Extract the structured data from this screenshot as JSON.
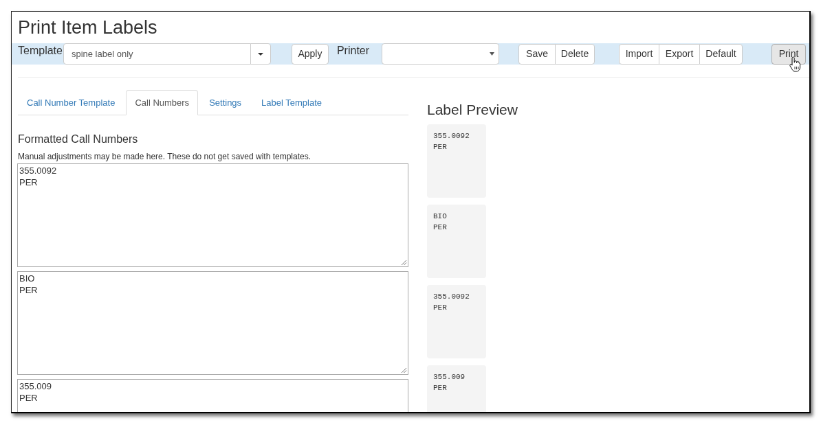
{
  "window": {
    "title": "Print Item Labels"
  },
  "toolbar": {
    "template_label": "Template",
    "template_field": {
      "value": "spine label only"
    },
    "apply_button": "Apply",
    "printer_label": "Printer",
    "template_buttons": [
      "Save",
      "Delete"
    ],
    "file_buttons": [
      "Import",
      "Export",
      "Default"
    ],
    "print_button": {
      "label": "Print",
      "hovered": true
    }
  },
  "tabs": [
    {
      "label": "Call Number Template",
      "selected": false
    },
    {
      "label": "Call Numbers",
      "selected": true
    },
    {
      "label": "Settings",
      "selected": false
    },
    {
      "label": "Label Template",
      "selected": false
    }
  ],
  "call_numbers": {
    "heading": "Formatted Call Numbers",
    "help": "Manual adjustments may be made here. These do not get saved with templates.",
    "entries": [
      {
        "lines": [
          "355.0092",
          "PER"
        ]
      },
      {
        "lines": [
          "BIO",
          "PER"
        ]
      },
      {
        "lines": [
          "355.009",
          "PER"
        ]
      }
    ]
  },
  "label_preview": {
    "heading": "Label Preview",
    "labels": [
      {
        "lines": [
          "355.0092",
          "PER"
        ]
      },
      {
        "lines": [
          "BIO",
          "PER"
        ]
      },
      {
        "lines": [
          "355.0092",
          "PER"
        ]
      },
      {
        "lines": [
          "355.009",
          "PER"
        ]
      }
    ]
  }
}
